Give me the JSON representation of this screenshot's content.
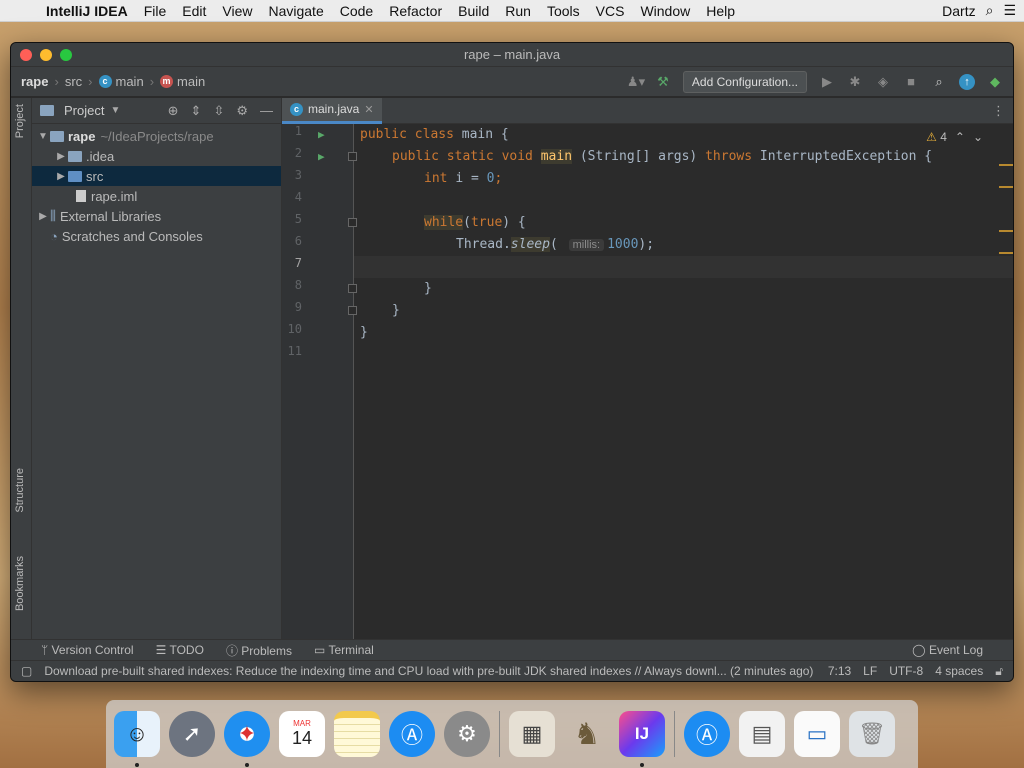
{
  "menubar": {
    "app": "IntelliJ IDEA",
    "items": [
      "File",
      "Edit",
      "View",
      "Navigate",
      "Code",
      "Refactor",
      "Build",
      "Run",
      "Tools",
      "VCS",
      "Window",
      "Help"
    ],
    "user": "Dartz"
  },
  "window": {
    "title": "rape – main.java"
  },
  "nav": {
    "project": "rape",
    "src": "src",
    "pkg": "main",
    "cls": "main",
    "add_config": "Add Configuration..."
  },
  "sidebar_tabs": {
    "project": "Project",
    "structure": "Structure",
    "bookmarks": "Bookmarks"
  },
  "project_panel": {
    "title": "Project",
    "root": "rape",
    "root_path": "~/IdeaProjects/rape",
    "items": [
      ".idea",
      "src",
      "rape.iml",
      "External Libraries",
      "Scratches and Consoles"
    ]
  },
  "editor": {
    "tab": "main.java",
    "warnings": "4",
    "line_numbers": [
      "1",
      "2",
      "3",
      "4",
      "5",
      "6",
      "7",
      "8",
      "9",
      "10",
      "11"
    ]
  },
  "code": {
    "l1a": "public class ",
    "l1b": "main {",
    "l2a": "public static void ",
    "l2b": "main",
    "l2c": " (String[] args) ",
    "l2d": "throws ",
    "l2e": "InterruptedException {",
    "l3a": "int ",
    "l3b": "i = ",
    "l3c": "0",
    "l3d": ";",
    "l5a": "while",
    "l5b": "(",
    "l5c": "true",
    "l5d": ") {",
    "l6a": "Thread.",
    "l6b": "sleep",
    "l6c": "( ",
    "l6hint": "millis:",
    "l6d": "1000",
    "l6e": ");",
    "l8": "}",
    "l9": "}",
    "l10": "}"
  },
  "bottom_tools": {
    "vc": "Version Control",
    "todo": "TODO",
    "problems": "Problems",
    "terminal": "Terminal",
    "event_log": "Event Log"
  },
  "status": {
    "message": "Download pre-built shared indexes: Reduce the indexing time and CPU load with pre-built JDK shared indexes // Always downl... (2 minutes ago)",
    "position": "7:13",
    "line_sep": "LF",
    "encoding": "UTF-8",
    "indent": "4 spaces"
  },
  "dock": {
    "calendar_month": "MAR",
    "calendar_day": "14",
    "ij": "IJ"
  }
}
